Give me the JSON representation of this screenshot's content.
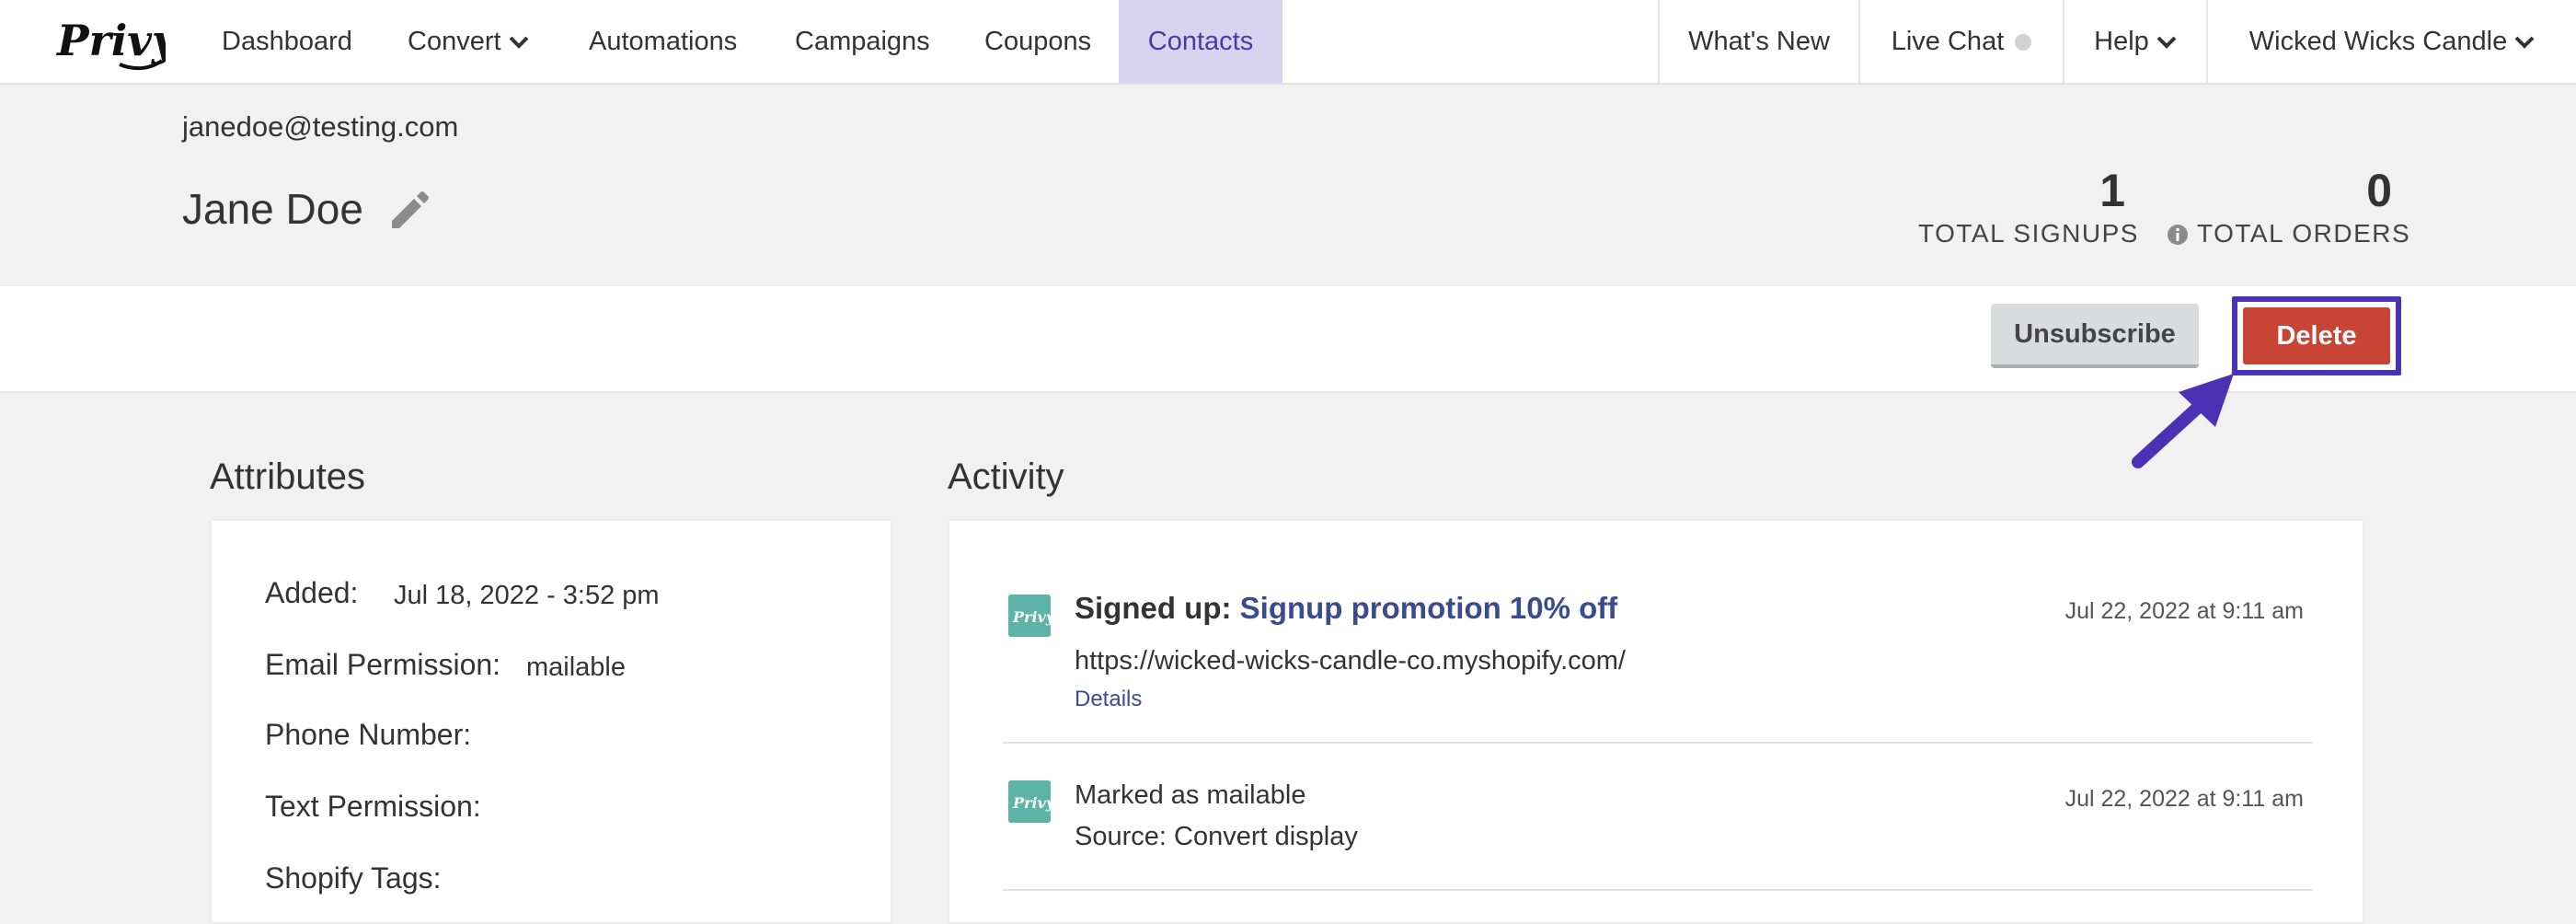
{
  "nav": {
    "logo_text": "Privy",
    "items": [
      {
        "label": "Dashboard"
      },
      {
        "label": "Convert",
        "dropdown": true
      },
      {
        "label": "Automations"
      },
      {
        "label": "Campaigns"
      },
      {
        "label": "Coupons"
      },
      {
        "label": "Contacts",
        "active": true
      }
    ],
    "right": {
      "whats_new": "What's New",
      "live_chat": "Live Chat",
      "help": "Help",
      "account": "Wicked Wicks Candle"
    }
  },
  "contact": {
    "email": "janedoe@testing.com",
    "name": "Jane Doe"
  },
  "stats": {
    "signups_value": "1",
    "signups_label": "TOTAL SIGNUPS",
    "orders_value": "0",
    "orders_label": "TOTAL ORDERS"
  },
  "actions": {
    "unsubscribe": "Unsubscribe",
    "delete": "Delete"
  },
  "attributes": {
    "title": "Attributes",
    "rows": [
      {
        "label": "Added:",
        "value": "Jul 18, 2022 - 3:52 pm"
      },
      {
        "label": "Email Permission:",
        "value": "mailable"
      },
      {
        "label": "Phone Number:",
        "value": ""
      },
      {
        "label": "Text Permission:",
        "value": ""
      },
      {
        "label": "Shopify Tags:",
        "value": ""
      }
    ]
  },
  "activity": {
    "title": "Activity",
    "items": [
      {
        "title_prefix": "Signed up:",
        "title_link": "Signup promotion 10% off",
        "time": "Jul 22, 2022 at 9:11 am",
        "line1": "https://wicked-wicks-candle-co.myshopify.com/",
        "details": "Details"
      },
      {
        "text": "Marked as mailable",
        "time": "Jul 22, 2022 at 9:11 am",
        "line2": "Source: Convert display"
      }
    ]
  },
  "colors": {
    "accent": "#4a32b5",
    "active_tab_bg": "#d8d3ef",
    "delete_red": "#c84535",
    "link_blue": "#3a4c8e",
    "privy_teal": "#5db3a7"
  },
  "icons": [
    "privy-logo",
    "chevron-down-icon",
    "pencil-icon",
    "info-icon",
    "arrow-icon",
    "privy-badge-icon"
  ]
}
